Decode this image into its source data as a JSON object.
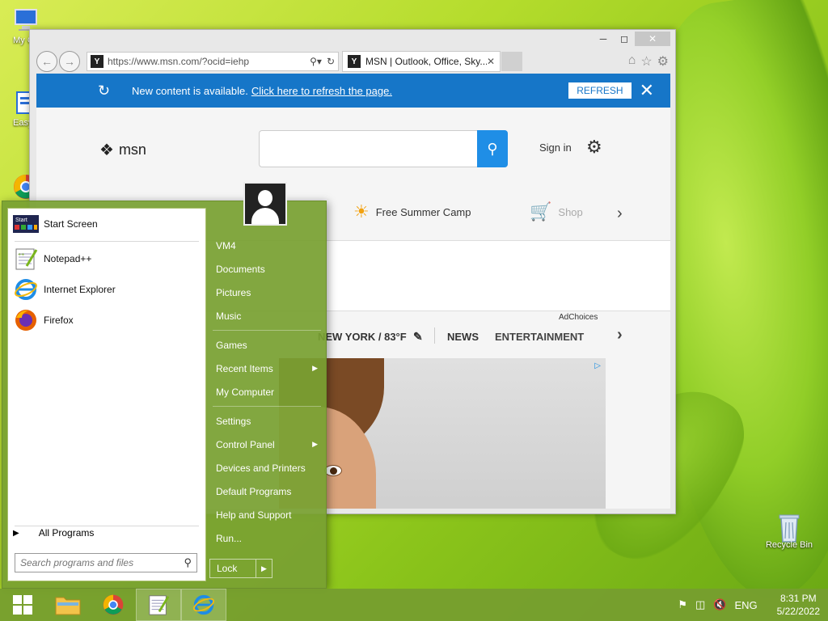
{
  "desktop": {
    "icons": [
      {
        "label": "My Co"
      },
      {
        "label": "EasyB"
      },
      {
        "label": "Recycle Bin"
      }
    ]
  },
  "ie": {
    "address": "https://www.msn.com/?ocid=iehp",
    "tab_title": "MSN | Outlook, Office, Sky...",
    "notification": {
      "message": "New content is available.",
      "link": "Click here to refresh the page.",
      "button": "REFRESH"
    },
    "msn": {
      "logo": "msn",
      "sign_in": "Sign in",
      "quick_links": [
        "Free Summer Camp",
        "Shop"
      ],
      "ad_choices": "AdChoices",
      "weather": "NEW YORK / 83°F",
      "nav": [
        "NEWS",
        "ENTERTAINMENT"
      ]
    }
  },
  "start_menu": {
    "programs": [
      {
        "label": "Start Screen",
        "icon": "start-screen-icon"
      },
      {
        "label": "Notepad++",
        "icon": "notepad-plus-plus-icon"
      },
      {
        "label": "Internet Explorer",
        "icon": "internet-explorer-icon"
      },
      {
        "label": "Firefox",
        "icon": "firefox-icon"
      }
    ],
    "all_programs": "All Programs",
    "search_placeholder": "Search programs and files",
    "right_group1": [
      "VM4",
      "Documents",
      "Pictures",
      "Music"
    ],
    "right_group2": [
      "Games",
      "Recent Items",
      "My Computer"
    ],
    "right_group3": [
      "Settings",
      "Control Panel",
      "Devices and Printers",
      "Default Programs",
      "Help and Support",
      "Run..."
    ],
    "lock": "Lock"
  },
  "taskbar": {
    "language": "ENG",
    "time": "8:31 PM",
    "date": "5/22/2022"
  },
  "colors": {
    "notification_blue": "#1676c8",
    "msn_search_blue": "#1f8ee6",
    "start_menu_green": "#78a032"
  }
}
